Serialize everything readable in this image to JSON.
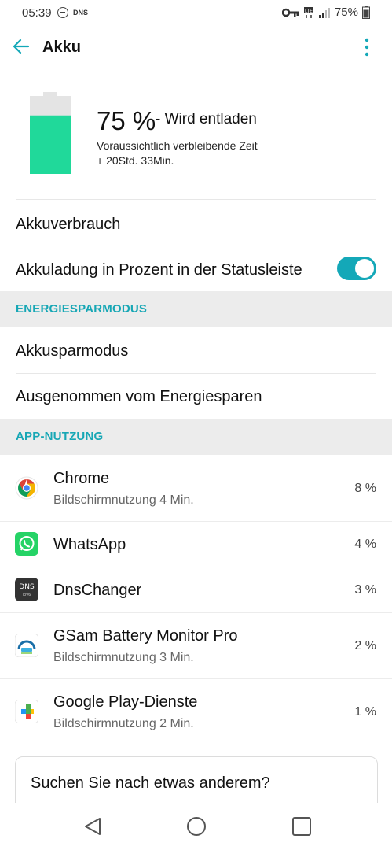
{
  "status": {
    "time": "05:39",
    "dns": "DNS",
    "battery_pct": "75%"
  },
  "header": {
    "title": "Akku"
  },
  "battery": {
    "percent": "75 %",
    "level": 0.75,
    "state": "- Wird entladen",
    "remaining_label": "Voraussichtlich verbleibende Zeit",
    "remaining_value": "+ 20Std. 33Min."
  },
  "rows": {
    "usage": "Akkuverbrauch",
    "statusbar_pct": "Akkuladung in Prozent in der Statusleiste"
  },
  "toggle_on": true,
  "section_energy": {
    "title": "ENERGIESPARMODUS",
    "items": [
      "Akkusparmodus",
      "Ausgenommen vom Energiesparen"
    ]
  },
  "section_apps": {
    "title": "APP-NUTZUNG",
    "apps": [
      {
        "name": "Chrome",
        "sub": "Bildschirmnutzung 4 Min.",
        "pct": "8 %",
        "icon": "chrome-icon"
      },
      {
        "name": "WhatsApp",
        "sub": "",
        "pct": "4 %",
        "icon": "whatsapp-icon"
      },
      {
        "name": "DnsChanger",
        "sub": "",
        "pct": "3 %",
        "icon": "dnschanger-icon",
        "icon_text": "DNS",
        "icon_subtext": "ipv6"
      },
      {
        "name": "GSam Battery Monitor Pro",
        "sub": "Bildschirmnutzung 3 Min.",
        "pct": "2 %",
        "icon": "gsam-icon"
      },
      {
        "name": "Google Play-Dienste",
        "sub": "Bildschirmnutzung 2 Min.",
        "pct": "1 %",
        "icon": "google-play-services-icon"
      }
    ]
  },
  "search": {
    "label": "Suchen Sie nach etwas anderem?"
  },
  "colors": {
    "accent": "#14a8b8",
    "battery_fill": "#20d99a",
    "battery_empty": "#e4e4e4"
  }
}
